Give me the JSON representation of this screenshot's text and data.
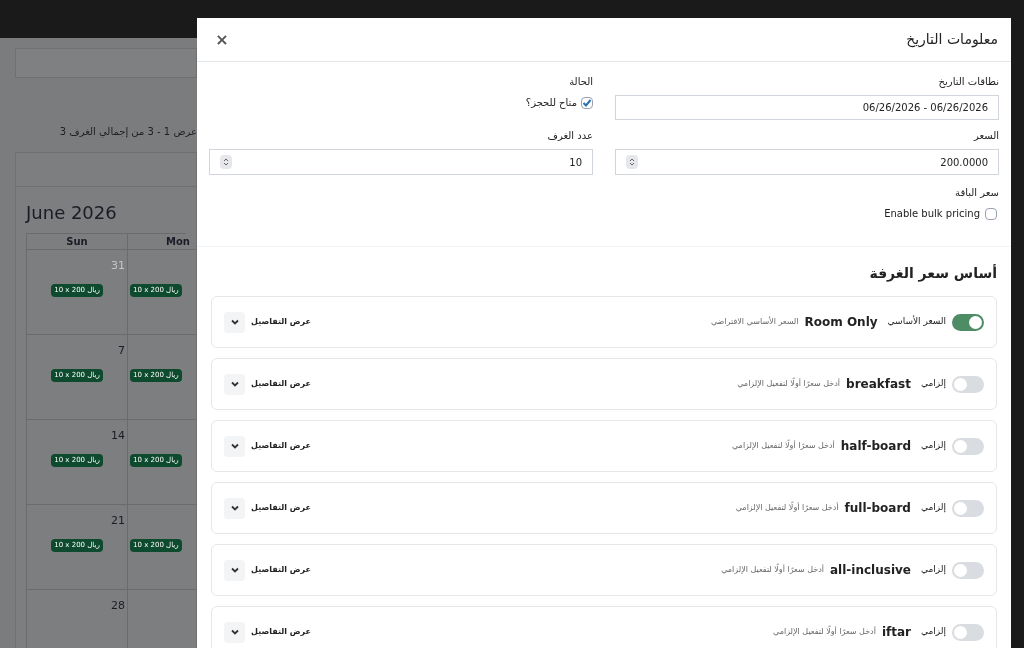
{
  "page": {
    "summary": "عرض 1 - 3 من إجمالي الغرف 3",
    "calendar": {
      "title": "June 2026",
      "sunday_column": {
        "header": "Sun",
        "cells": [
          {
            "day": "31",
            "muted": true,
            "badge": "10 x ريال 200"
          },
          {
            "day": "7",
            "muted": false,
            "badge": "10 x ريال 200"
          },
          {
            "day": "14",
            "muted": false,
            "badge": "10 x ريال 200"
          },
          {
            "day": "21",
            "muted": false,
            "badge": "10 x ريال 200"
          },
          {
            "day": "28",
            "muted": false
          }
        ]
      },
      "monday_column": {
        "header": "Mon",
        "cells": [
          {
            "badge": "10 x ريال 200"
          },
          {
            "badge": "10 x ريال 200"
          },
          {
            "badge": "10 x ريال 200"
          },
          {
            "badge": "10 x ريال 200"
          },
          {}
        ]
      }
    }
  },
  "modal": {
    "title": "معلومات التاريخ",
    "close": "×",
    "date_range": {
      "label": "نطاقات التاريخ",
      "value": "06/26/2026 - 06/26/2026"
    },
    "status": {
      "label": "الحالة",
      "checkbox": {
        "label": "متاح للحجز؟",
        "checked": true
      }
    },
    "price": {
      "label": "السعر",
      "value": "200.0000"
    },
    "rooms": {
      "label": "عدد الغرف",
      "value": "10"
    },
    "package_price": {
      "label": "سعر الباقة",
      "checkbox": {
        "label": "Enable bulk pricing",
        "checked": false
      }
    },
    "section_title": "أساس سعر الغرفة",
    "plans": [
      {
        "toggle_label": "السعر الأساسي",
        "on": true,
        "name": "Room Only",
        "note": "السعر الأساسي الافتراضي",
        "details": "عرض التفاصيل"
      },
      {
        "toggle_label": "إلزامي",
        "on": false,
        "name": "breakfast",
        "note": "أدخل سعرًا أولًا لتفعيل الإلزامي",
        "details": "عرض التفاصيل"
      },
      {
        "toggle_label": "إلزامي",
        "on": false,
        "name": "half-board",
        "note": "أدخل سعرًا أولًا لتفعيل الإلزامي",
        "details": "عرض التفاصيل"
      },
      {
        "toggle_label": "إلزامي",
        "on": false,
        "name": "full-board",
        "note": "أدخل سعرًا أولًا لتفعيل الإلزامي",
        "details": "عرض التفاصيل"
      },
      {
        "toggle_label": "إلزامي",
        "on": false,
        "name": "all-inclusive",
        "note": "أدخل سعرًا أولًا لتفعيل الإلزامي",
        "details": "عرض التفاصيل"
      },
      {
        "toggle_label": "إلزامي",
        "on": false,
        "name": "iftar",
        "note": "أدخل سعرًا أولًا لتفعيل الإلزامي",
        "details": "عرض التفاصيل"
      }
    ]
  }
}
